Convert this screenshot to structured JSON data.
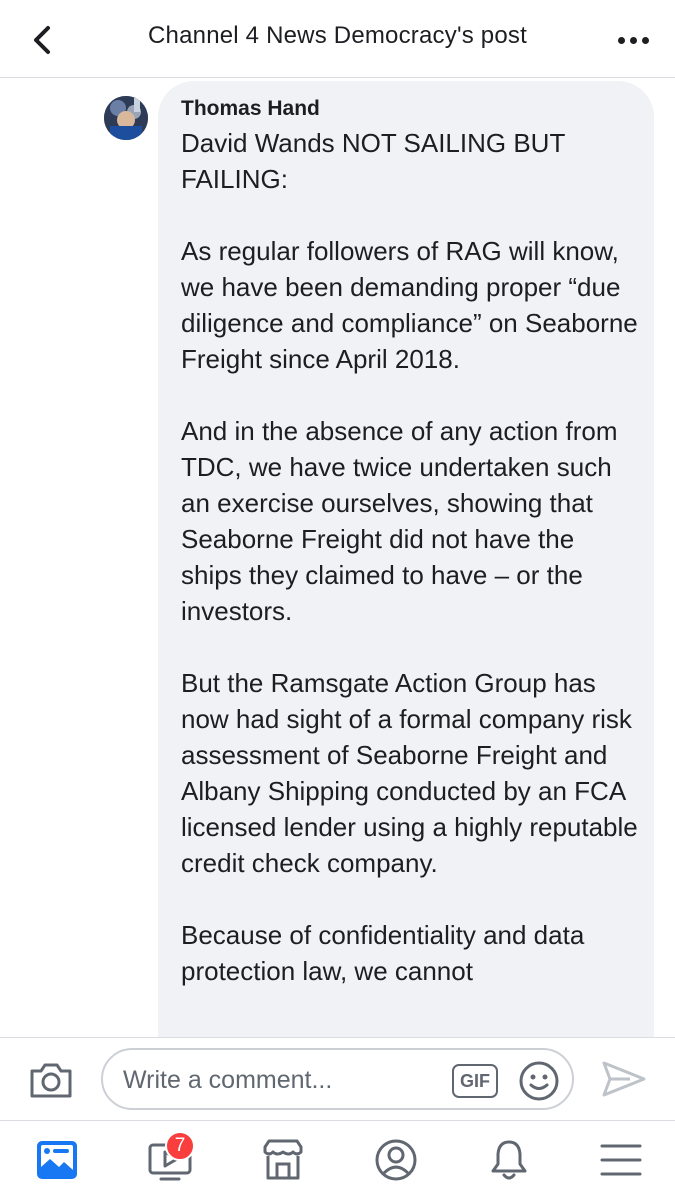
{
  "header": {
    "title": "Channel 4 News Democracy's post",
    "back_icon": "chevron-left-icon",
    "more_icon": "more-horizontal-icon"
  },
  "comment": {
    "author": "Thomas Hand",
    "paragraphs": [
      "David Wands NOT SAILING BUT FAILING:",
      "As regular followers of RAG will know, we have been demanding proper “due diligence and compliance” on Seaborne Freight since April 2018.",
      "And in the absence of any action from TDC, we have twice undertaken such an exercise ourselves, showing that Seaborne Freight did not have the ships they claimed to have – or the investors.",
      "But the Ramsgate Action Group has now had sight of a formal company risk assessment of Seaborne Freight and Albany Shipping conducted by an FCA licensed lender using a highly reputable credit check company.",
      "Because of confidentiality and data protection law, we cannot"
    ]
  },
  "composer": {
    "placeholder": "Write a comment...",
    "gif_label": "GIF",
    "camera_icon": "camera-icon",
    "emoji_icon": "emoji-icon",
    "send_icon": "send-icon"
  },
  "tabbar": {
    "tabs": [
      {
        "name": "news-feed",
        "icon": "news-feed-icon",
        "active": true
      },
      {
        "name": "watch",
        "icon": "video-icon",
        "badge": "7"
      },
      {
        "name": "marketplace",
        "icon": "marketplace-icon"
      },
      {
        "name": "profile",
        "icon": "profile-icon"
      },
      {
        "name": "notifications",
        "icon": "bell-icon"
      },
      {
        "name": "menu",
        "icon": "menu-icon"
      }
    ]
  },
  "colors": {
    "active_tab": "#1877f2",
    "inactive_icon": "#606770",
    "bubble": "#f0f2f5",
    "badge": "#fa3e3e"
  }
}
